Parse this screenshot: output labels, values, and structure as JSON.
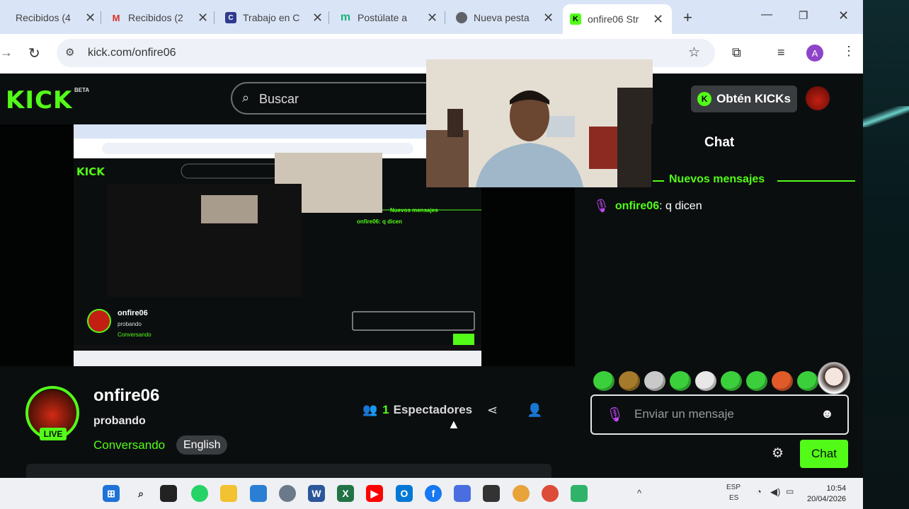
{
  "browser": {
    "tabs": [
      {
        "label": "Recibidos (4",
        "icon": "gmail-icon",
        "color": "#d93025"
      },
      {
        "label": "Recibidos (2",
        "icon": "gmail-icon",
        "color": "#d93025"
      },
      {
        "label": "Trabajo en C",
        "icon": "computrabajo-icon",
        "color": "#2f3a8f"
      },
      {
        "label": "Postúlate a",
        "icon": "m-green-icon",
        "color": "#19b27a"
      },
      {
        "label": "Nueva pesta",
        "icon": "chrome-icon",
        "color": "#5f6368"
      },
      {
        "label": "onfire06 Str",
        "icon": "kick-icon",
        "color": "#53fc18"
      }
    ],
    "new_tab": "+",
    "url": "kick.com/onfire06",
    "profile_initial": "A"
  },
  "kick": {
    "logo": "KICK",
    "beta": "BETA",
    "search_placeholder": "Buscar",
    "kicks_button": "Obtén KICKs"
  },
  "chat": {
    "title": "Chat",
    "new_messages": "Nuevos mensajes",
    "messages": [
      {
        "user": "onfire06",
        "text": ": q dicen"
      }
    ],
    "input_placeholder": "Enviar un mensaje",
    "send_label": "Chat"
  },
  "channel": {
    "name": "onfire06",
    "stream_title": "probando",
    "category": "Conversando",
    "language": "English",
    "live": "LIVE",
    "viewers_count": "1",
    "viewers_label": "Espectadores"
  },
  "taskbar": {
    "lang_top": "ESP",
    "lang_bottom": "ES",
    "time": "10:54",
    "date": "20/04/2026"
  },
  "colors": {
    "kick_green": "#53fc18",
    "page_bg": "#0b0e0f"
  }
}
